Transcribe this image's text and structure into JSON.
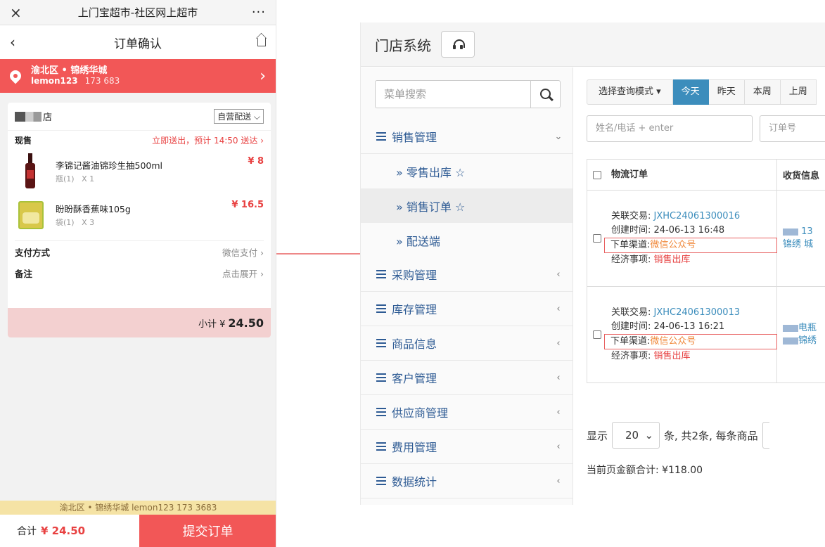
{
  "phone": {
    "topbar": {
      "close": "×",
      "title": "上门宝超市-社区网上超市",
      "more": "···"
    },
    "navbar": {
      "back": "‹",
      "title": "订单确认"
    },
    "address": {
      "line1": "渝北区 • 锦绣华城",
      "user": "lemon123",
      "phone": "173       683",
      "chevron": "›"
    },
    "store": {
      "name": "店",
      "delivery_option": "自营配送 ⌵"
    },
    "sale": {
      "label": "现售",
      "delivery_note": "立即送出，预计 14:50 送达 ›"
    },
    "items": [
      {
        "name": "李锦记酱油锦珍生抽500ml",
        "unit": "瓶(1)",
        "qty": "X 1",
        "price": "¥ 8"
      },
      {
        "name": "盼盼酥香蕉味105g",
        "unit": "袋(1)",
        "qty": "X 3",
        "price": "¥ 16.5"
      }
    ],
    "payment": {
      "label": "支付方式",
      "value": "微信支付 ›"
    },
    "remark": {
      "label": "备注",
      "value": "点击展开 ›"
    },
    "subtotal": {
      "label": "小计 ¥",
      "amount": "24.50"
    },
    "address_strip": "渝北区 • 锦绣华城   lemon123  173        3683",
    "footer": {
      "total_label": "合计",
      "total_amount": "¥ 24.50",
      "submit": "提交订单"
    }
  },
  "admin": {
    "title": "门店系统",
    "search_placeholder": "菜单搜索",
    "menu": [
      {
        "label": "销售管理",
        "caret": "⌄"
      },
      {
        "label": "采购管理",
        "caret": "‹"
      },
      {
        "label": "库存管理",
        "caret": "‹"
      },
      {
        "label": "商品信息",
        "caret": "‹"
      },
      {
        "label": "客户管理",
        "caret": "‹"
      },
      {
        "label": "供应商管理",
        "caret": "‹"
      },
      {
        "label": "费用管理",
        "caret": "‹"
      },
      {
        "label": "数据统计",
        "caret": "‹"
      }
    ],
    "submenu": [
      {
        "label": "» 零售出库 ☆"
      },
      {
        "label": "» 销售订单 ☆"
      },
      {
        "label": "» 配送端"
      }
    ],
    "filters": {
      "mode": "选择查询模式 ▾",
      "today": "今天",
      "yesterday": "昨天",
      "this_week": "本周",
      "last_week": "上周"
    },
    "inputs": {
      "name_phone": "姓名/电话 + enter",
      "order_no": "订单号"
    },
    "table": {
      "headers": {
        "logistics": "物流订单",
        "receiver": "收货信息"
      },
      "labels": {
        "related": "关联交易:",
        "created": "创建时间:",
        "channel": "下单渠道:",
        "economic": "经济事项:"
      },
      "rows": [
        {
          "trade_no": "JXHC24061300016",
          "created": "24-06-13 16:48",
          "channel": "微信公众号",
          "economic": "销售出库",
          "receiver_line1": "13",
          "receiver_line2": "锦绣      城"
        },
        {
          "trade_no": "JXHC24061300013",
          "created": "24-06-13 16:21",
          "channel": "微信公众号",
          "economic": "销售出库",
          "receiver_line1": "电瓶",
          "receiver_line2": "锦绣"
        }
      ]
    },
    "pager": {
      "show": "显示",
      "page_size": "20",
      "summary": "条, 共2条, 每条商品"
    },
    "page_total": "当前页金额合计: ¥118.00"
  }
}
